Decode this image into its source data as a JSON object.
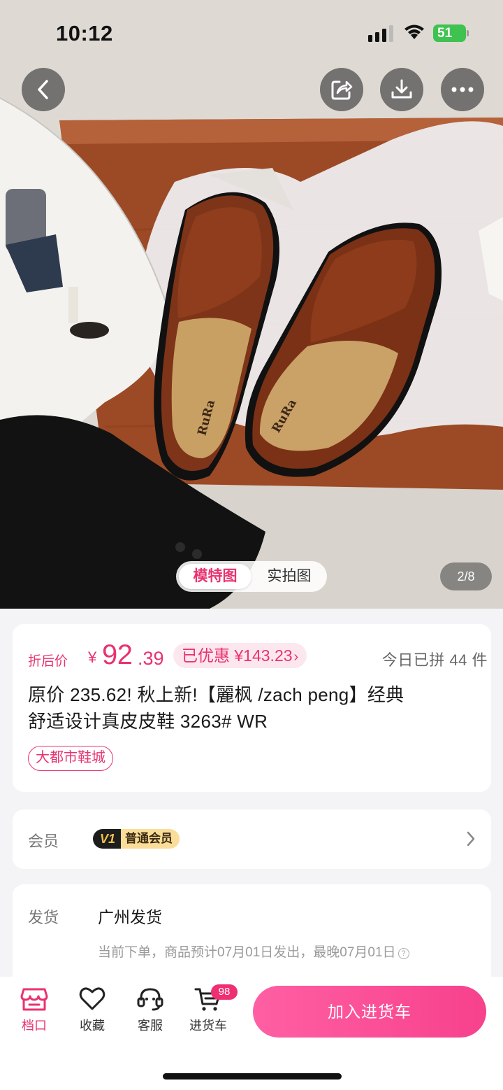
{
  "status_bar": {
    "time": "10:12",
    "battery": "51"
  },
  "gallery": {
    "view_options": [
      "模特图",
      "实拍图"
    ],
    "selected_view": "模特图",
    "counter": "2/8",
    "shoe_brand_text": "RuRa"
  },
  "price": {
    "label": "折后价",
    "currency": "¥",
    "integer": "92",
    "decimal": ".39",
    "saved": "已优惠 ¥143.23",
    "sold_today": "今日已拼 44 件"
  },
  "product": {
    "title_line1": "原价 235.62! 秋上新!【麗枫 /zach peng】经典",
    "title_line2": "舒适设计真皮皮鞋  3263#  WR",
    "market_tag": "大都市鞋城"
  },
  "member": {
    "label": "会员",
    "level": "V1",
    "level_name": "普通会员"
  },
  "shipping": {
    "label": "发货",
    "from": "广州发货",
    "eta": "当前下单，商品预计07月01日发出，最晚07月01日"
  },
  "bottom_nav": {
    "items": [
      {
        "label": "档口",
        "icon": "store-icon"
      },
      {
        "label": "收藏",
        "icon": "heart-icon"
      },
      {
        "label": "客服",
        "icon": "headset-icon"
      },
      {
        "label": "进货车",
        "icon": "cart-icon"
      }
    ],
    "cart_count": "98",
    "add_to_cart": "加入进货车"
  },
  "colors": {
    "accent": "#e8336e",
    "button": "#f7418c"
  }
}
